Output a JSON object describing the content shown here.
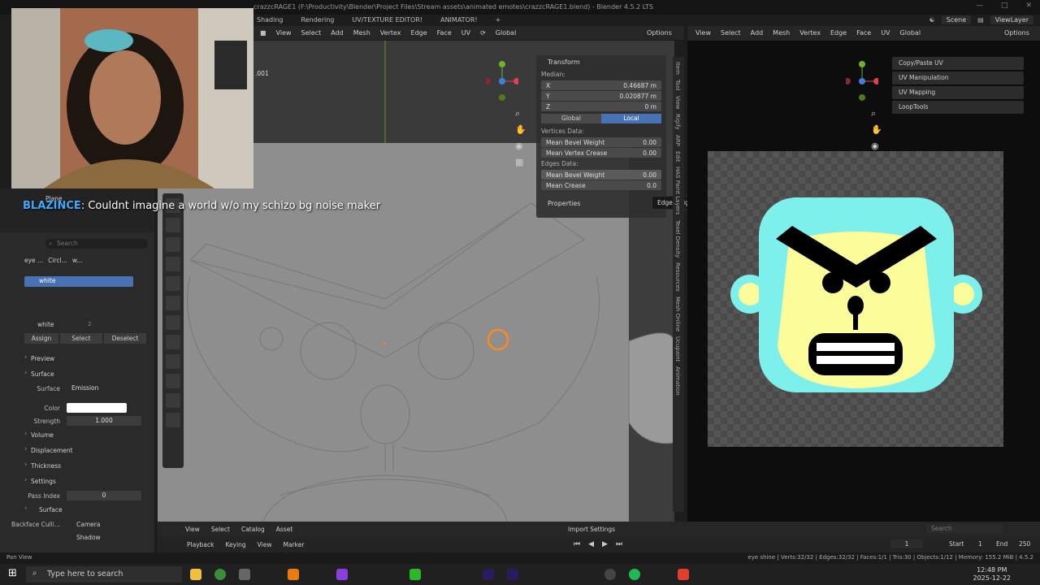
{
  "window": {
    "title": "crazzcRAGE1 (F:\\Productivity\\Blender\\Project Files\\Stream assets\\animated emotes\\crazzcRAGE1.blend) - Blender 4.5.2 LTS"
  },
  "workspaces": [
    "Shading",
    "Rendering",
    "UV/TEXTURE EDITOR!",
    "ANIMATOR!",
    "+"
  ],
  "topbar": {
    "scene": "Scene",
    "view_layer": "ViewLayer"
  },
  "viewport_header": {
    "menus": [
      "View",
      "Select",
      "Add",
      "Mesh",
      "Vertex",
      "Edge",
      "Face",
      "UV"
    ],
    "orientation": "Global",
    "options": "Options",
    "obj_suffix": ".001"
  },
  "uv_header": {
    "menus": [
      "View",
      "Select",
      "Add",
      "Mesh",
      "Vertex",
      "Edge",
      "Face",
      "UV"
    ],
    "orientation": "Global",
    "options": "Options"
  },
  "npanel": {
    "transform": "Transform",
    "median": "Median:",
    "x_label": "X",
    "x_value": "0.46687 m",
    "y_label": "Y",
    "y_value": "0.020877 m",
    "z_label": "Z",
    "z_value": "0 m",
    "global": "Global",
    "local": "Local",
    "vertices_data": "Vertices Data:",
    "mean_bevel_weight": "Mean Bevel Weight",
    "mean_bevel_weight_val": "0.00",
    "mean_vertex_crease": "Mean Vertex Crease",
    "mean_vertex_crease_val": "0.00",
    "edges_data": "Edges Data:",
    "edge_bevel_weight": "Mean Bevel Weight",
    "edge_bevel_weight_val": "0.00",
    "mean_crease": "Mean Crease",
    "mean_crease_val": "0.0",
    "properties": "Properties"
  },
  "tooltip": "Edge weight used by Bevel modifier.",
  "side_tabs": [
    "Item",
    "Tool",
    "View",
    "Rigify",
    "ARP",
    "Edit",
    "HAS Paint Layers",
    "Texel Density",
    "Resources",
    "Mesh Online",
    "Ucupaint",
    "Animation"
  ],
  "uv_addons": [
    "Copy/Paste UV",
    "UV Manipulation",
    "UV Mapping",
    "LoopTools"
  ],
  "chat": {
    "user": "BLAZINCE",
    "message": ": Couldnt imagine a world w/o my schizo bg noise maker"
  },
  "outliner": {
    "item": "Plane"
  },
  "properties": {
    "search_placeholder": "Search",
    "crumbs": [
      "eye ...",
      "Circl...",
      "w..."
    ],
    "slot": "white",
    "material_name": "white",
    "users": "2",
    "assign": "Assign",
    "select": "Select",
    "deselect": "Deselect",
    "preview": "Preview",
    "surface": "Surface",
    "surface_label": "Surface",
    "surface_value": "Emission",
    "color_label": "Color",
    "strength_label": "Strength",
    "strength_value": "1.000",
    "volume": "Volume",
    "displacement": "Displacement",
    "thickness": "Thickness",
    "settings": "Settings",
    "pass_index_label": "Pass Index",
    "pass_index_value": "0",
    "surface_sub": "Surface",
    "backface_label": "Backface Culli...",
    "camera": "Camera",
    "shadow": "Shadow"
  },
  "asset_header": {
    "menus": [
      "View",
      "Select",
      "Catalog",
      "Asset"
    ],
    "import_settings": "Import Settings",
    "search_placeholder": "Search"
  },
  "timeline": {
    "menus": [
      "Playback",
      "Keying",
      "View",
      "Marker"
    ],
    "frame": "1",
    "start_label": "Start",
    "start": "1",
    "end_label": "End",
    "end": "250"
  },
  "statusbar": {
    "left": "Pan View",
    "right": "eye shine | Verts:32/32 | Edges:32/32 | Faces:1/1 | Tris:30 | Objects:1/12 | Memory: 155.2 MiB | 4.5.2"
  },
  "taskbar": {
    "search_placeholder": "Type here to search",
    "time": "12:48 PM",
    "date": "2025-12-22"
  },
  "colors": {
    "accent": "#4772b3",
    "uv_face": "#fbfd9a",
    "uv_bg_shape": "#7ef0ec",
    "chat_user": "#3fa9ff"
  }
}
